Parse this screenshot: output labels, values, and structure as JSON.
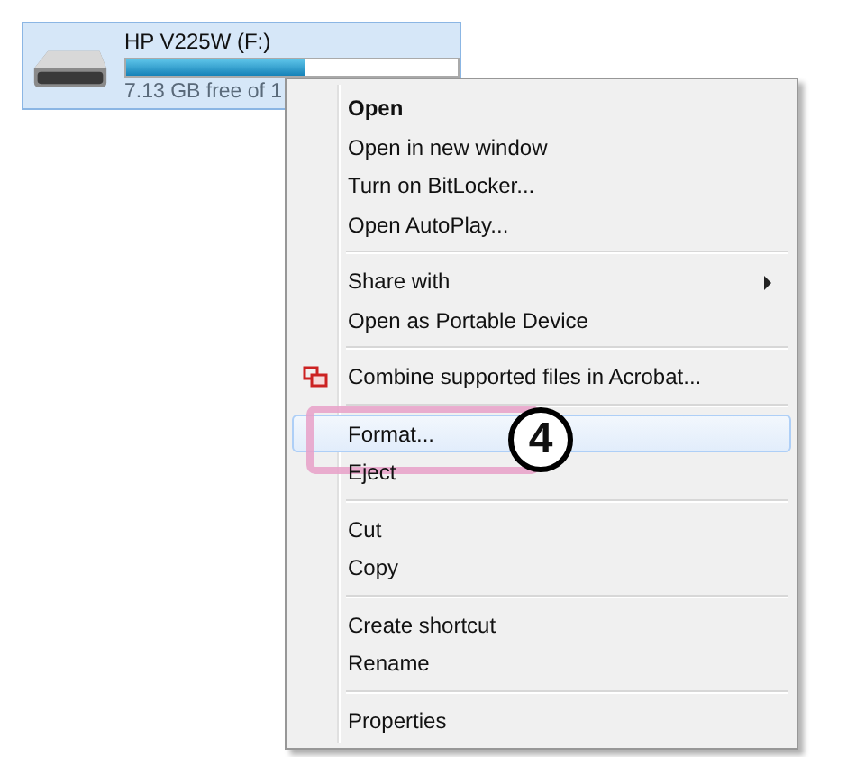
{
  "drive": {
    "name": "HP V225W (F:)",
    "free_text": "7.13 GB free of 1",
    "level": 0.54,
    "selected": true
  },
  "context_menu": {
    "groups": [
      [
        {
          "label": "Open",
          "default": true,
          "submenu": false,
          "selected": false
        },
        {
          "label": "Open in new window",
          "default": false,
          "submenu": false,
          "selected": false
        },
        {
          "label": "Turn on BitLocker...",
          "default": false,
          "submenu": false,
          "selected": false
        },
        {
          "label": "Open AutoPlay...",
          "default": false,
          "submenu": false,
          "selected": false
        }
      ],
      [
        {
          "label": "Share with",
          "default": false,
          "submenu": true,
          "selected": false
        },
        {
          "label": "Open as Portable Device",
          "default": false,
          "submenu": false,
          "selected": false
        }
      ],
      [
        {
          "label": "Combine supported files in Acrobat...",
          "default": false,
          "submenu": false,
          "selected": false,
          "kind": "acrobat"
        }
      ],
      [
        {
          "label": "Format...",
          "default": false,
          "submenu": false,
          "selected": true,
          "callout": "4"
        },
        {
          "label": "Eject",
          "default": false,
          "submenu": false,
          "selected": false
        }
      ],
      [
        {
          "label": "Cut",
          "default": false,
          "submenu": false,
          "selected": false
        },
        {
          "label": "Copy",
          "default": false,
          "submenu": false,
          "selected": false
        }
      ],
      [
        {
          "label": "Create shortcut",
          "default": false,
          "submenu": false,
          "selected": false
        },
        {
          "label": "Rename",
          "default": false,
          "submenu": false,
          "selected": false
        }
      ],
      [
        {
          "label": "Properties",
          "default": false,
          "submenu": false,
          "selected": false
        }
      ]
    ]
  }
}
